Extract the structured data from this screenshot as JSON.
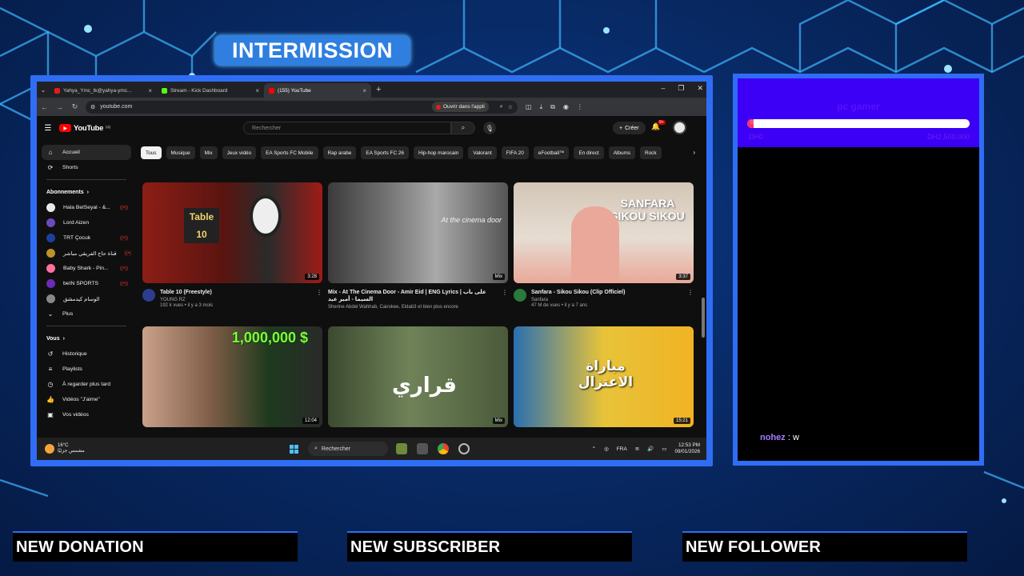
{
  "overlay": {
    "intermission": "INTERMISSION",
    "alerts": [
      "NEW DONATION",
      "NEW SUBSCRIBER",
      "NEW FOLLOWER"
    ]
  },
  "browser": {
    "tabs": [
      {
        "label": "Yahya_Ymc_tk@yahya-ymc...",
        "color": "#e21d1d"
      },
      {
        "label": "Stream - Kick Dashboard",
        "color": "#53fc18"
      },
      {
        "label": "(155) YouTube",
        "color": "#ff0000"
      }
    ],
    "url": "youtube.com",
    "open_app": "Ouvrir dans l'appli"
  },
  "youtube": {
    "logo": "YouTube",
    "logo_region": "FR",
    "search_placeholder": "Rechercher",
    "create": "Créer",
    "notif_count": "9+",
    "sidebar": {
      "main": [
        {
          "label": "Accueil",
          "icon": "home-icon"
        },
        {
          "label": "Shorts",
          "icon": "shorts-icon"
        }
      ],
      "subs_heading": "Abonnements",
      "subs": [
        {
          "label": "Hala BelSeyal - &...",
          "color": "#eaeaea"
        },
        {
          "label": "Lord Aizen",
          "color": "#6a4bbf"
        },
        {
          "label": "TRT Çocuk",
          "color": "#1b3f9e"
        },
        {
          "label": "قناة حاج الفريقي مباشر",
          "color": "#c0902a"
        },
        {
          "label": "Baby Shark - Pin...",
          "color": "#ff6fa0"
        },
        {
          "label": "beIN SPORTS",
          "color": "#6a2cb8"
        },
        {
          "label": "الوسام كيدمشق",
          "color": "#888888"
        }
      ],
      "more": "Plus",
      "you_heading": "Vous",
      "you": [
        {
          "label": "Historique",
          "icon": "history-icon"
        },
        {
          "label": "Playlists",
          "icon": "playlist-icon"
        },
        {
          "label": "À regarder plus tard",
          "icon": "clock-icon"
        },
        {
          "label": "Vidéos \"J'aime\"",
          "icon": "thumbs-up-icon"
        },
        {
          "label": "Vos vidéos",
          "icon": "video-icon"
        }
      ]
    },
    "chips": [
      "Tous",
      "Musique",
      "Mix",
      "Jeux vidéo",
      "EA Sports FC Mobile",
      "Rap arabe",
      "EA Sports FC 26",
      "Hip-hop marocain",
      "Valorant",
      "FIFA 20",
      "eFootball™",
      "En direct",
      "Albums",
      "Rock"
    ],
    "videos": [
      {
        "title": "Table 10 (Freestyle)",
        "channel": "YOUNG RZ",
        "stats": "192 k vues • il y a 3 mois",
        "duration": "3:28",
        "thumb_text": "Table 10",
        "thumb_color": "#7a1a14",
        "avatar_color": "#2c3e8f"
      },
      {
        "title": "Mix - At The Cinema Door - Amir Eid | ENG Lyrics | على باب السيما - أمير عيد",
        "channel": "Sherine Abdel Wahhab, Cairokee, Eldab3 et bien plus encore",
        "stats": "",
        "duration": "Mix",
        "thumb_text": "At the cinema door",
        "thumb_color": "#5d5d5d",
        "avatar_color": ""
      },
      {
        "title": "Sanfara - Sikou Sikou (Clip Officiel)",
        "channel": "Sanfara",
        "stats": "47 M de vues • il y a 7 ans",
        "duration": "3:37",
        "thumb_text": "SANFARA SIKOU SIKOU",
        "thumb_color": "#d7c9b5",
        "avatar_color": "#2a7a3b"
      },
      {
        "title": "",
        "channel": "",
        "stats": "",
        "duration": "12:04",
        "thumb_text": "1,000,000 $",
        "thumb_color": "#2a6b2a",
        "avatar_color": ""
      },
      {
        "title": "",
        "channel": "",
        "stats": "",
        "duration": "Mix",
        "thumb_text": "قراري",
        "thumb_color": "#50663f",
        "avatar_color": ""
      },
      {
        "title": "",
        "channel": "",
        "stats": "",
        "duration": "15:21",
        "thumb_text": "مباراة الاعتزال",
        "thumb_color": "#f0b323",
        "avatar_color": ""
      }
    ]
  },
  "taskbar": {
    "weather_temp": "16°C",
    "weather_desc": "مشمس جزئيًا",
    "search": "Rechercher",
    "lang": "FRA",
    "time": "12:53 PM",
    "date": "09/01/2026"
  },
  "goal": {
    "title": "pc gamer",
    "bar_label": "0",
    "left": "DH0",
    "right": "DH2,500.000",
    "progress": 0.03
  },
  "chat": {
    "user": "nohez",
    "message": ": w"
  }
}
